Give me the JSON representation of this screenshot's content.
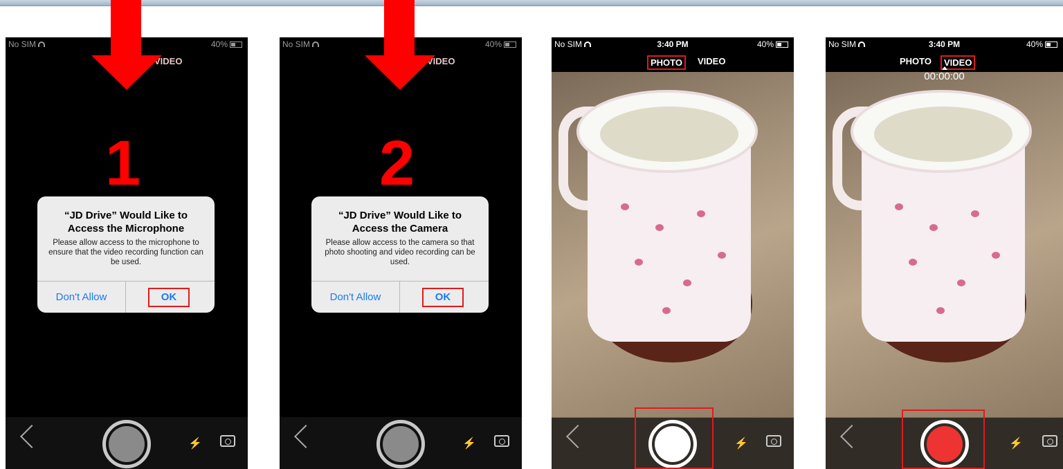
{
  "status": {
    "carrier": "No SIM",
    "time": "3:40 PM",
    "battery": "40%"
  },
  "modes": {
    "photo": "PHOTO",
    "video": "VIDEO"
  },
  "steps": [
    "1",
    "2"
  ],
  "dialogs": [
    {
      "title_line1": "“JD Drive” Would Like to",
      "title_line2": "Access the Microphone",
      "message": "Please allow access to the microphone to ensure that the video recording function can be used.",
      "deny": "Don't Allow",
      "ok": "OK"
    },
    {
      "title_line1": "“JD Drive” Would Like to",
      "title_line2": "Access the Camera",
      "message": "Please allow access to the camera so that photo shooting and video recording can be used.",
      "deny": "Don't Allow",
      "ok": "OK"
    }
  ],
  "timer": "00:00:00",
  "icons": {
    "back": "chevron-left-icon",
    "flash": "flash-off-icon",
    "switch_camera": "camera-switch-icon"
  },
  "colors": {
    "highlight": "#e01b1b",
    "arrow": "#ff0000",
    "ios_blue": "#1a7bf2",
    "record": "#ee3333"
  }
}
